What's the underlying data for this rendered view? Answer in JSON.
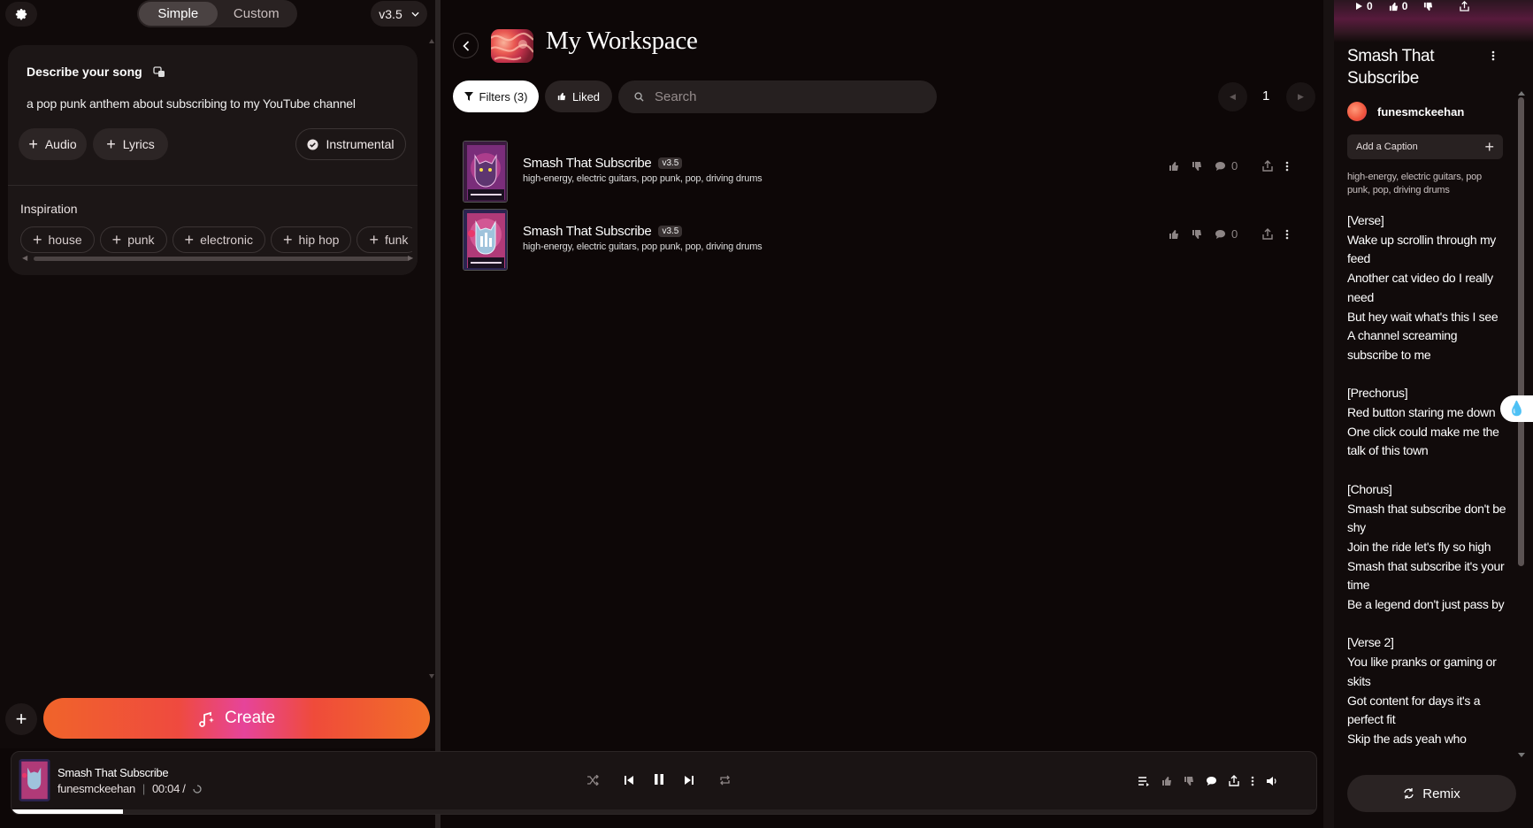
{
  "sidebar": {
    "modes": [
      "Simple",
      "Custom"
    ],
    "active_mode": "Simple",
    "version": "v3.5",
    "describe_label": "Describe your song",
    "prompt_text": "a pop punk anthem about subscribing to my YouTube channel",
    "audio_label": "Audio",
    "lyrics_label": "Lyrics",
    "instrumental_label": "Instrumental",
    "inspiration_label": "Inspiration",
    "inspiration_chips": [
      "house",
      "punk",
      "electronic",
      "hip hop",
      "funk"
    ],
    "create_label": "Create"
  },
  "workspace": {
    "title": "My Workspace",
    "filters_label": "Filters (3)",
    "liked_label": "Liked",
    "search_placeholder": "Search",
    "page": "1",
    "songs": [
      {
        "title": "Smash That Subscribe",
        "version": "v3.5",
        "tags": "high-energy, electric guitars, pop punk, pop, driving drums",
        "comments": "0"
      },
      {
        "title": "Smash That Subscribe",
        "version": "v3.5",
        "tags": "high-energy, electric guitars, pop punk, pop, driving drums",
        "comments": "0"
      }
    ]
  },
  "detail": {
    "plays": "0",
    "likes": "0",
    "title": "Smash That Subscribe",
    "author": "funesmckeehan",
    "caption_placeholder": "Add a Caption",
    "tags": "high-energy, electric guitars, pop punk, pop, driving drums",
    "lyrics": "[Verse]\nWake up scrollin through my feed\nAnother cat video do I really need\nBut hey wait what's this I see\nA channel screaming subscribe to me\n\n[Prechorus]\nRed button staring me down\nOne click could make me the talk of this town\n\n[Chorus]\nSmash that subscribe don't be shy\nJoin the ride let's fly so high\nSmash that subscribe it's your time\nBe a legend don't just pass by\n\n[Verse 2]\nYou like pranks or gaming or skits\nGot content for days it's a perfect fit\nSkip the ads yeah who",
    "remix_label": "Remix"
  },
  "player": {
    "title": "Smash That Subscribe",
    "author": "funesmckeehan",
    "time": "00:04 /",
    "progress": 0.085
  },
  "colors": {
    "background": "#0d0707",
    "create_gradient_start": "#f0642a",
    "create_gradient_mid": "#e6449a",
    "accent_white": "#ffffff"
  }
}
